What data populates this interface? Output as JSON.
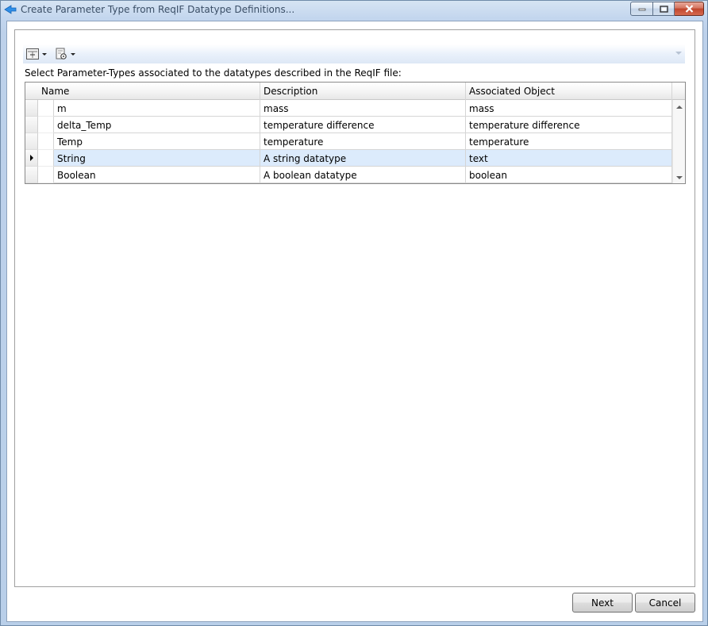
{
  "window": {
    "title": "Create Parameter Type from ReqIF Datatype Definitions..."
  },
  "toolbar": {
    "items": [
      {
        "icon": "grid-layout-icon"
      },
      {
        "icon": "settings-document-icon"
      }
    ]
  },
  "instruction": "Select Parameter-Types associated to the datatypes described in the ReqIF file:",
  "grid": {
    "columns": [
      "Name",
      "Description",
      "Associated Object"
    ],
    "rows": [
      {
        "name": "m",
        "description": "mass",
        "associated": "mass"
      },
      {
        "name": "delta_Temp",
        "description": "temperature difference",
        "associated": "temperature difference"
      },
      {
        "name": "Temp",
        "description": "temperature",
        "associated": "temperature"
      },
      {
        "name": "String",
        "description": "A string datatype",
        "associated": "text"
      },
      {
        "name": "Boolean",
        "description": "A boolean datatype",
        "associated": "boolean"
      }
    ],
    "current_row": 3
  },
  "buttons": {
    "next": "Next",
    "cancel": "Cancel"
  },
  "colors": {
    "selected_row": "#dcebfc",
    "window_frame": "#bdd1ea",
    "close_button": "#c0452c"
  }
}
